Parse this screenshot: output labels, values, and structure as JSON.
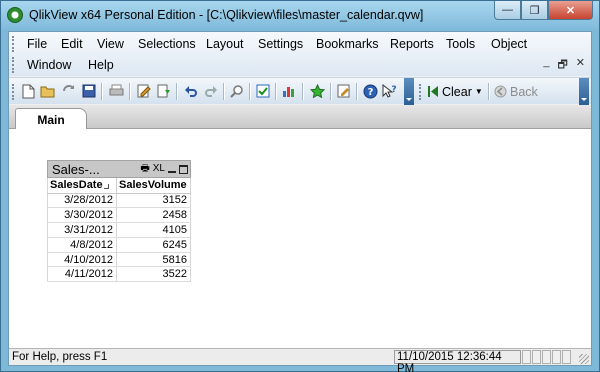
{
  "window": {
    "title": "QlikView x64 Personal Edition - [C:\\Qlikview\\files\\master_calendar.qvw]",
    "buttons": {
      "minimize": "—",
      "restore": "❐",
      "close": "✕"
    }
  },
  "menu": {
    "row1": [
      "File",
      "Edit",
      "View",
      "Selections",
      "Layout",
      "Settings",
      "Bookmarks",
      "Reports",
      "Tools",
      "Object"
    ],
    "row2": [
      "Window",
      "Help"
    ],
    "mdi": {
      "minimize": "_",
      "restore": "🗗",
      "close": "✕"
    }
  },
  "toolbar": {
    "clear_label": "Clear",
    "back_label": "Back",
    "icons": [
      "new-icon",
      "open-icon",
      "reload-icon",
      "save-icon",
      "print-icon",
      "edit-script-icon",
      "reload-data-icon",
      "undo-icon",
      "redo-icon",
      "search-icon",
      "check-icon",
      "chart-wizard-icon",
      "bookmark-star-icon",
      "sheet-properties-icon",
      "help-icon",
      "context-help-icon"
    ]
  },
  "tabs": [
    {
      "label": "Main"
    }
  ],
  "tablebox": {
    "caption": "Sales-...",
    "caption_icons": {
      "print": "🖶",
      "excel": "XL"
    },
    "columns": [
      "SalesDate",
      "SalesVolume"
    ],
    "rows": [
      [
        "3/28/2012",
        "3152"
      ],
      [
        "3/30/2012",
        "2458"
      ],
      [
        "3/31/2012",
        "4105"
      ],
      [
        "4/8/2012",
        "6245"
      ],
      [
        "4/10/2012",
        "5816"
      ],
      [
        "4/11/2012",
        "3522"
      ]
    ]
  },
  "status": {
    "help_text": "For Help, press F1",
    "datetime": "11/10/2015 12:36:44 PM"
  },
  "colors": {
    "frame": "#7fb9d8",
    "toolbar_accent": "#2c5f93",
    "caption_bg": "#c7c7c7"
  }
}
